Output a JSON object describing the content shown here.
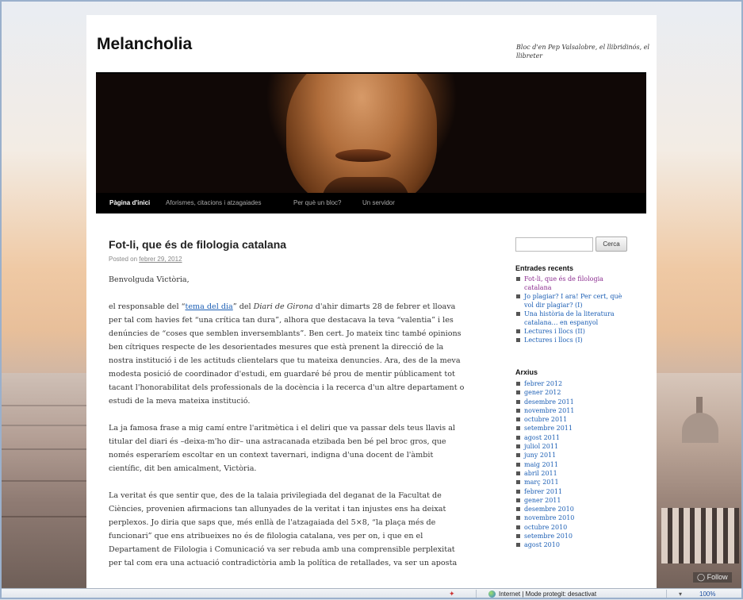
{
  "site": {
    "title": "Melancholia",
    "description": "Bloc d'en Pep Valsalobre, el llibridinós, el llibreter"
  },
  "nav": {
    "items": [
      "Pàgina d'inici",
      "Aforismes, citacions i atzagaiades",
      "Per què un bloc?",
      "Un servidor"
    ]
  },
  "post": {
    "title": "Fot-li, que és de filologia catalana",
    "posted_on": "Posted on",
    "date": "febrer 29, 2012",
    "greeting": "Benvolguda Victòria,",
    "p1_pre": "el responsable del “",
    "p1_link": "tema del dia",
    "p1_mid": "” del ",
    "p1_italic": "Diari de Girona",
    "p1_post": " d'ahir dimarts 28 de febrer et lloava per tal com havies fet “una crítica tan dura”, alhora que destacava la teva “valentia” i les denúncies de “coses que semblen inversemblants”. Ben cert. Jo mateix tinc també opinions ben cítriques respecte de les desorientades mesures que està prenent la direcció de la nostra institució i de les actituds clientelars que tu mateixa denuncies. Ara, des de la meva modesta posició de coordinador d'estudi, em guardaré bé prou de mentir públicament tot tacant l'honorabilitat dels professionals de la docència i la recerca d'un altre departament o estudi de la meva mateixa institució.",
    "p2": "La ja famosa frase a mig camí entre l'aritmètica i el deliri que va passar dels teus llavis al titular del diari és –deixa-m'ho dir– una astracanada etzibada ben bé pel broc gros, que només esperaríem escoltar en un context tavernari, indigna d'una docent de l'àmbit científic, dit ben amicalment, Victòria.",
    "p3": "La veritat és que sentir que, des de la talaia privilegiada del deganat de la Facultat de Ciències, provenien afirmacions tan allunyades de la veritat i tan injustes ens ha deixat perplexos. Jo diria que saps que, més enllà de l'atzagaiada del 5×8, “la plaça més de funcionari” que ens atribueixes no és de filologia catalana, ves per on, i que en el Departament de Filologia i Comunicació va ser rebuda amb una comprensible perplexitat per tal com era una actuació contradictòria amb la política de retallades, va ser un aposta"
  },
  "search": {
    "placeholder": "",
    "button_label": "Cerca"
  },
  "recent": {
    "title": "Entrades recents",
    "items": [
      "Fot-li, que és de filologia catalana",
      "Jo plagiar? I ara! Per cert, què vol dir plagiar? (I)",
      "Una història de la literatura catalana… en espanyol",
      "Lectures i llocs (II)",
      "Lectures i llocs (I)"
    ]
  },
  "archives": {
    "title": "Arxius",
    "items": [
      "febrer 2012",
      "gener 2012",
      "desembre 2011",
      "novembre 2011",
      "octubre 2011",
      "setembre 2011",
      "agost 2011",
      "juliol 2011",
      "juny 2011",
      "maig 2011",
      "abril 2011",
      "març 2011",
      "febrer 2011",
      "gener 2011",
      "desembre 2010",
      "novembre 2010",
      "octubre 2010",
      "setembre 2010",
      "agost 2010"
    ]
  },
  "follow": {
    "label": "Follow"
  },
  "statusbar": {
    "zone": "Internet | Mode protegit: desactivat",
    "zoom": "100%",
    "zoom_arrow": "▾"
  }
}
